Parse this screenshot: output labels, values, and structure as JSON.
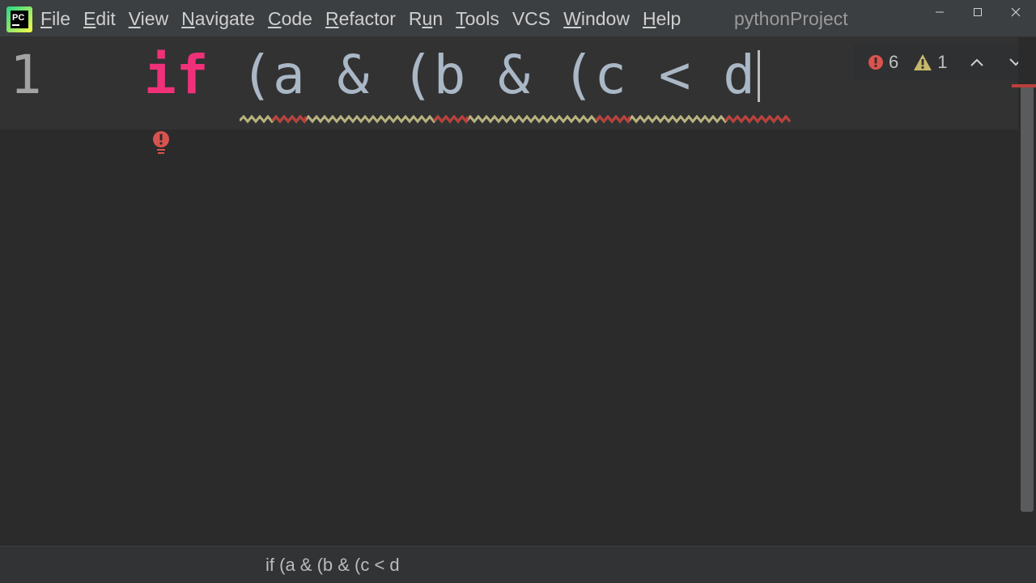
{
  "window": {
    "project_name": "pythonProject",
    "app_icon": "pycharm-logo-icon",
    "app_icon_text": "PC"
  },
  "menu": [
    {
      "label": "File",
      "mnemonic": "F"
    },
    {
      "label": "Edit",
      "mnemonic": "E"
    },
    {
      "label": "View",
      "mnemonic": "V"
    },
    {
      "label": "Navigate",
      "mnemonic": "N"
    },
    {
      "label": "Code",
      "mnemonic": "C"
    },
    {
      "label": "Refactor",
      "mnemonic": "R"
    },
    {
      "label": "Run",
      "mnemonic": "u"
    },
    {
      "label": "Tools",
      "mnemonic": "T"
    },
    {
      "label": "VCS",
      "mnemonic": ""
    },
    {
      "label": "Window",
      "mnemonic": "W"
    },
    {
      "label": "Help",
      "mnemonic": "H"
    }
  ],
  "window_controls": [
    "minimize-icon",
    "maximize-icon",
    "close-icon"
  ],
  "editor": {
    "line_number": "1",
    "code_keyword": "if",
    "code_rest": " (a & (b & (c < d"
  },
  "inspections": {
    "errors": "6",
    "warnings": "1",
    "error_color": "#d9534f",
    "warning_color": "#c7b86b"
  },
  "colors": {
    "keyword": "#f0317a",
    "identifier": "#a9b7c6",
    "error_underline": "#bc3f3c",
    "warning_underline": "#b8b37f"
  },
  "breadcrumb": {
    "text": "if (a & (b & (c < d"
  }
}
